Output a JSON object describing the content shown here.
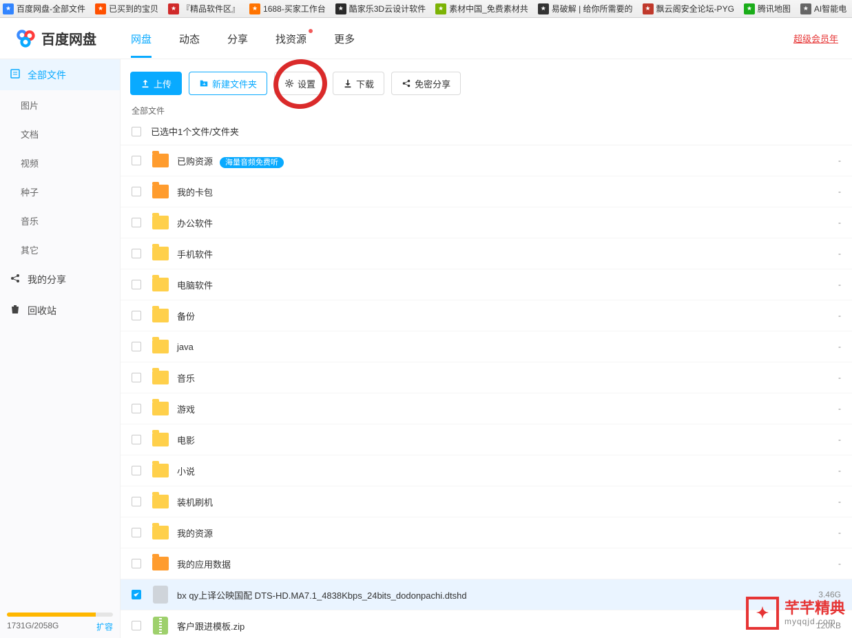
{
  "bookmarks": [
    {
      "label": "百度网盘-全部文件",
      "icon": "baidu",
      "color": "#3385ff"
    },
    {
      "label": "已买到的宝贝",
      "icon": "taobao",
      "color": "#ff5000"
    },
    {
      "label": "『精品软件区』",
      "icon": "soft",
      "color": "#d02a2a"
    },
    {
      "label": "1688-买家工作台",
      "icon": "1688",
      "color": "#ff7300"
    },
    {
      "label": "酷家乐3D云设计软件",
      "icon": "kujiale",
      "color": "#2a2a2a"
    },
    {
      "label": "素材中国_免费素材共",
      "icon": "sucai",
      "color": "#7cb305"
    },
    {
      "label": "易破解 | 给你所需要的",
      "icon": "yipojie",
      "color": "#333"
    },
    {
      "label": "飘云阁安全论坛-PYG",
      "icon": "pyg",
      "color": "#c0392b"
    },
    {
      "label": "腾讯地图",
      "icon": "tencent",
      "color": "#1aad19"
    },
    {
      "label": "AI智能电",
      "icon": "ai",
      "color": "#666"
    }
  ],
  "logo_text": "百度网盘",
  "nav": [
    {
      "label": "网盘",
      "active": true
    },
    {
      "label": "动态"
    },
    {
      "label": "分享"
    },
    {
      "label": "找资源",
      "dot": true
    },
    {
      "label": "更多"
    }
  ],
  "vip_link": "超级会员年",
  "sidebar": {
    "items": [
      {
        "label": "全部文件",
        "icon": "files",
        "active": true
      },
      {
        "label": "图片",
        "sub": true
      },
      {
        "label": "文档",
        "sub": true
      },
      {
        "label": "视频",
        "sub": true
      },
      {
        "label": "种子",
        "sub": true
      },
      {
        "label": "音乐",
        "sub": true
      },
      {
        "label": "其它",
        "sub": true
      },
      {
        "label": "我的分享",
        "icon": "share"
      },
      {
        "label": "回收站",
        "icon": "trash"
      }
    ],
    "storage_text": "1731G/2058G",
    "expand_label": "扩容"
  },
  "toolbar": {
    "upload": "上传",
    "new_folder": "新建文件夹",
    "settings": "设置",
    "download": "下载",
    "share": "免密分享"
  },
  "breadcrumb": "全部文件",
  "selection_text": "已选中1个文件/文件夹",
  "files": [
    {
      "name": "已购资源",
      "icon": "sysfolder",
      "badge": "海量音频免费听",
      "meta": "-"
    },
    {
      "name": "我的卡包",
      "icon": "sysfolder",
      "meta": "-"
    },
    {
      "name": "办公软件",
      "icon": "folder",
      "meta": "-"
    },
    {
      "name": "手机软件",
      "icon": "folder",
      "meta": "-"
    },
    {
      "name": "电脑软件",
      "icon": "folder",
      "meta": "-"
    },
    {
      "name": "备份",
      "icon": "folder",
      "meta": "-"
    },
    {
      "name": "java",
      "icon": "folder",
      "meta": "-"
    },
    {
      "name": "音乐",
      "icon": "folder",
      "meta": "-"
    },
    {
      "name": "游戏",
      "icon": "folder",
      "meta": "-"
    },
    {
      "name": "电影",
      "icon": "folder",
      "meta": "-"
    },
    {
      "name": "小说",
      "icon": "folder",
      "meta": "-"
    },
    {
      "name": "装机刷机",
      "icon": "folder",
      "meta": "-"
    },
    {
      "name": "我的资源",
      "icon": "folder",
      "meta": "-"
    },
    {
      "name": "我的应用数据",
      "icon": "sysfolder",
      "meta": "-"
    },
    {
      "name": "bx qy上译公映国配 DTS-HD.MA7.1_4838Kbps_24bits_dodonpachi.dtshd",
      "icon": "file",
      "meta": "3.46G",
      "selected": true
    },
    {
      "name": "客户跟进模板.zip",
      "icon": "zip",
      "meta": "120KB"
    }
  ],
  "watermark": {
    "main": "芊芊精典",
    "sub": "myqqjd.com"
  }
}
